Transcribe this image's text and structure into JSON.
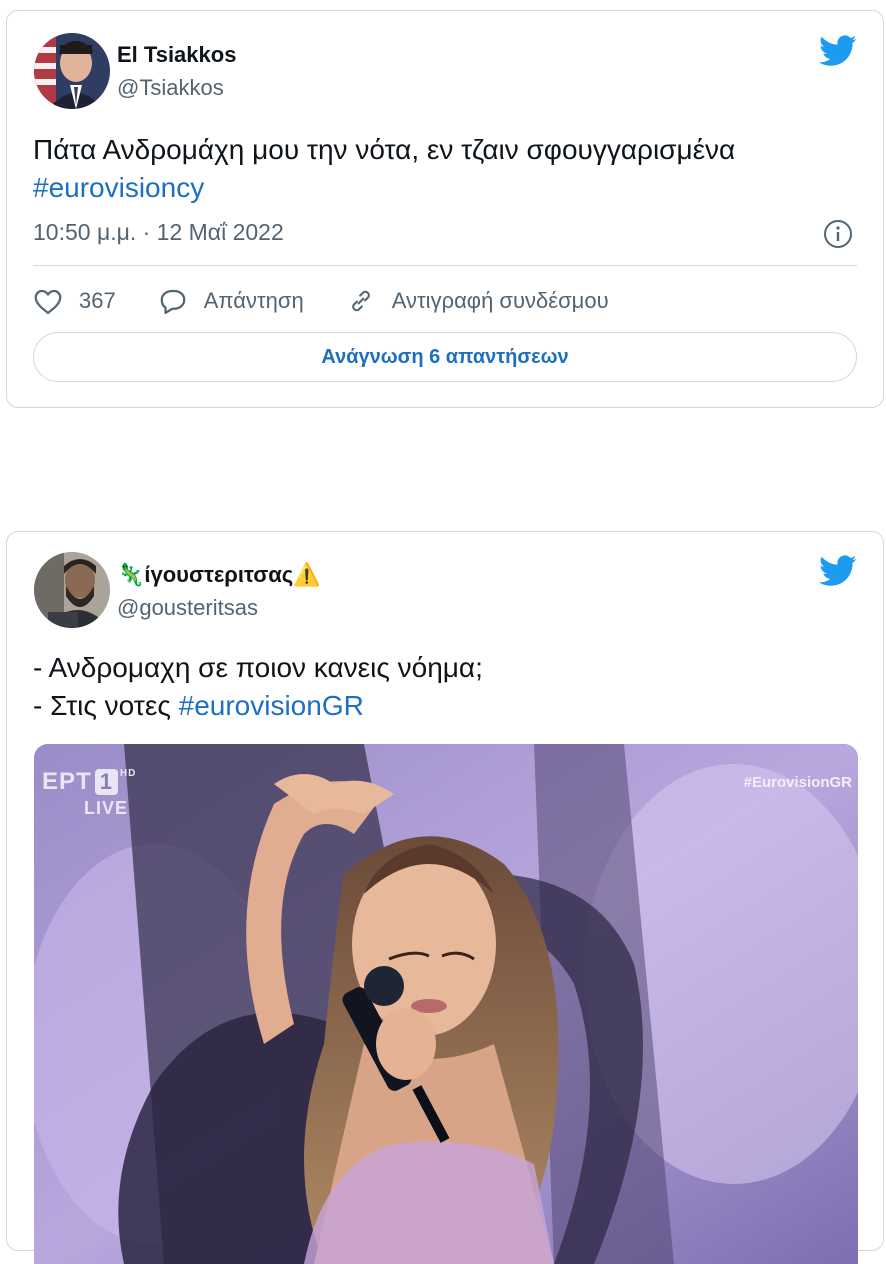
{
  "tweets": [
    {
      "author_name": "El Tsiakkos",
      "handle": "@Tsiakkos",
      "text_line1": "Πάτα Ανδρομάχη μου την νότα, εν τζαιν σφουγγαρισμένα",
      "hashtag": "#eurovisioncy",
      "timestamp": "10:50 μ.μ. · 12 Μαΐ 2022",
      "likes": "367",
      "reply_label": "Απάντηση",
      "copy_link_label": "Αντιγραφή συνδέσμου",
      "read_replies_label": "Ανάγνωση 6 απαντήσεων"
    },
    {
      "author_name": "🦎ίγουστεριτσας⚠️",
      "handle": "@gousteritsas",
      "text_line1": "- Ανδρομαχη σε ποιον κανεις νόημα;",
      "text_line2_prefix": "- Στις νοτες ",
      "hashtag": "#eurovisionGR",
      "media": {
        "channel_logo": "ΕΡΤ",
        "channel_number": "1",
        "channel_hd": "HD",
        "live_label": "LIVE",
        "overlay_hashtag": "#EurovisionGR"
      }
    }
  ],
  "icons": [
    "twitter-bird-icon",
    "info-icon",
    "heart-icon",
    "reply-bubble-icon",
    "link-icon"
  ],
  "colors": {
    "accent": "#1d6fc0",
    "twitter_blue": "#1d9bf0",
    "secondary_text": "#536471",
    "border": "#cfd9de"
  }
}
